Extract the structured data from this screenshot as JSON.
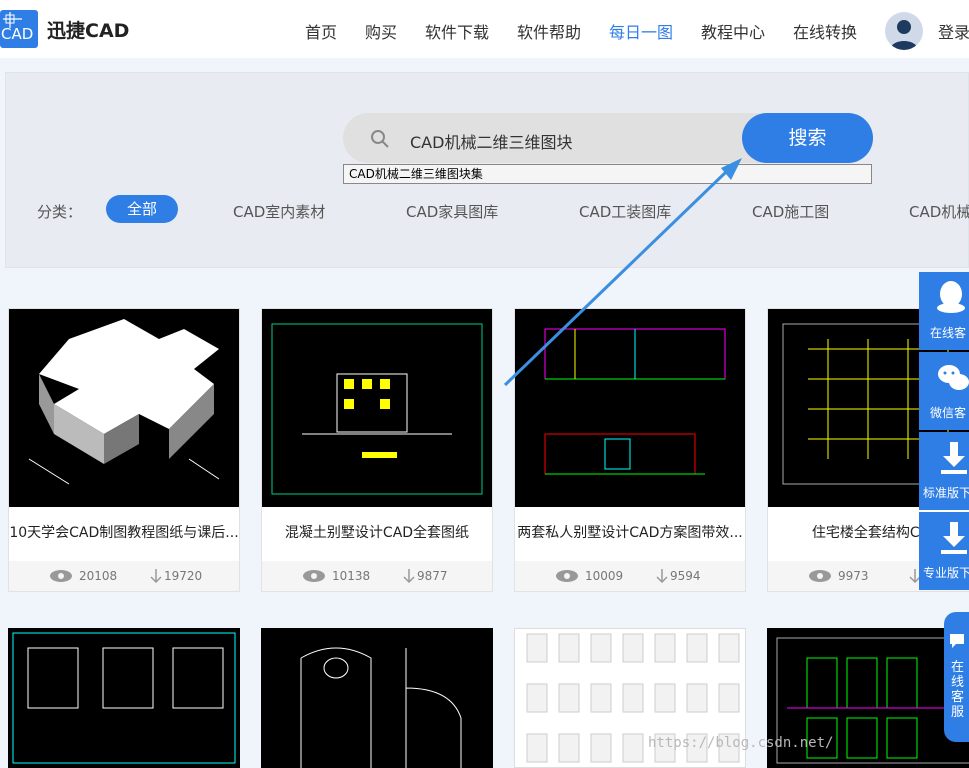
{
  "header": {
    "logo_icon_text": "CAD",
    "logo_text": "迅捷CAD",
    "nav": [
      "首页",
      "购买",
      "软件下载",
      "软件帮助",
      "每日一图",
      "教程中心",
      "在线转换"
    ],
    "active_nav": "每日一图",
    "login_label": "登录"
  },
  "search": {
    "query": "CAD机械二维三维图块",
    "button_label": "搜索",
    "suggestion": "CAD机械二维三维图块集"
  },
  "categories": {
    "label": "分类：",
    "items": [
      "全部",
      "CAD室内素材",
      "CAD家具图库",
      "CAD工装图库",
      "CAD施工图",
      "CAD机械"
    ]
  },
  "cards": [
    {
      "title": "10天学会CAD制图教程图纸与课后...",
      "views": "20108",
      "downloads": "19720"
    },
    {
      "title": "混凝土别墅设计CAD全套图纸",
      "views": "10138",
      "downloads": "9877"
    },
    {
      "title": "两套私人别墅设计CAD方案图带效...",
      "views": "10009",
      "downloads": "9594"
    },
    {
      "title": "住宅楼全套结构CAD施",
      "views": "9973",
      "downloads": ""
    }
  ],
  "sidebar": [
    "在线客",
    "微信客",
    "标准版下",
    "专业版下"
  ],
  "kefu_label": "在线客服",
  "watermark": "https://blog.csdn.net/",
  "colors": {
    "accent": "#2f7ee6",
    "arrow": "#3a8fe0"
  }
}
